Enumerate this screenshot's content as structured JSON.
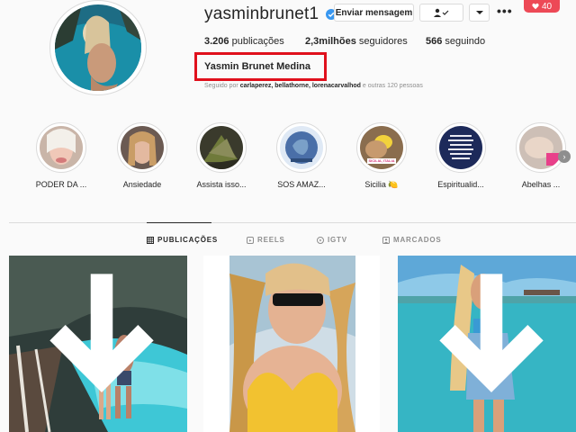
{
  "profile": {
    "username": "yasminbrunet1",
    "verified_icon": "verified-badge-icon",
    "buttons": {
      "message": "Enviar mensagem",
      "following_icon": "person-check-icon",
      "dropdown_icon": "chevron-down-icon",
      "more_icon": "more-options-icon"
    },
    "stats": {
      "posts_value": "3.206",
      "posts_label": "publicações",
      "followers_value": "2,3milhões",
      "followers_label": "seguidores",
      "following_value": "566",
      "following_label": "seguindo"
    },
    "full_name": "Yasmin Brunet Medina",
    "followed_by": {
      "prefix": "Seguido por",
      "names": "carlaperez, bellathorne, lorenacarvalhod",
      "suffix": "e outras 120 pessoas"
    }
  },
  "notification": {
    "icon": "heart-icon",
    "count": "40"
  },
  "highlights": [
    {
      "label": "PODER DA ..."
    },
    {
      "label": "Ansiedade"
    },
    {
      "label": "Assista isso..."
    },
    {
      "label": "SOS AMAZ..."
    },
    {
      "label": "Sicilia 🍋"
    },
    {
      "label": "Espiritualid..."
    },
    {
      "label": "Abelhas ..."
    }
  ],
  "highlight_sticker": "SICILIA, ITALIA",
  "tabs": [
    {
      "label": "PUBLICAÇÕES",
      "icon": "grid-icon",
      "active": true
    },
    {
      "label": "REELS",
      "icon": "reels-icon",
      "active": false
    },
    {
      "label": "IGTV",
      "icon": "igtv-icon",
      "active": false
    },
    {
      "label": "MARCADOS",
      "icon": "tagged-icon",
      "active": false
    }
  ],
  "colors": {
    "accent_red": "#e0101c",
    "notification": "#ed4956",
    "text": "#262626",
    "muted": "#8e8e8e",
    "border": "#dbdbdb"
  }
}
